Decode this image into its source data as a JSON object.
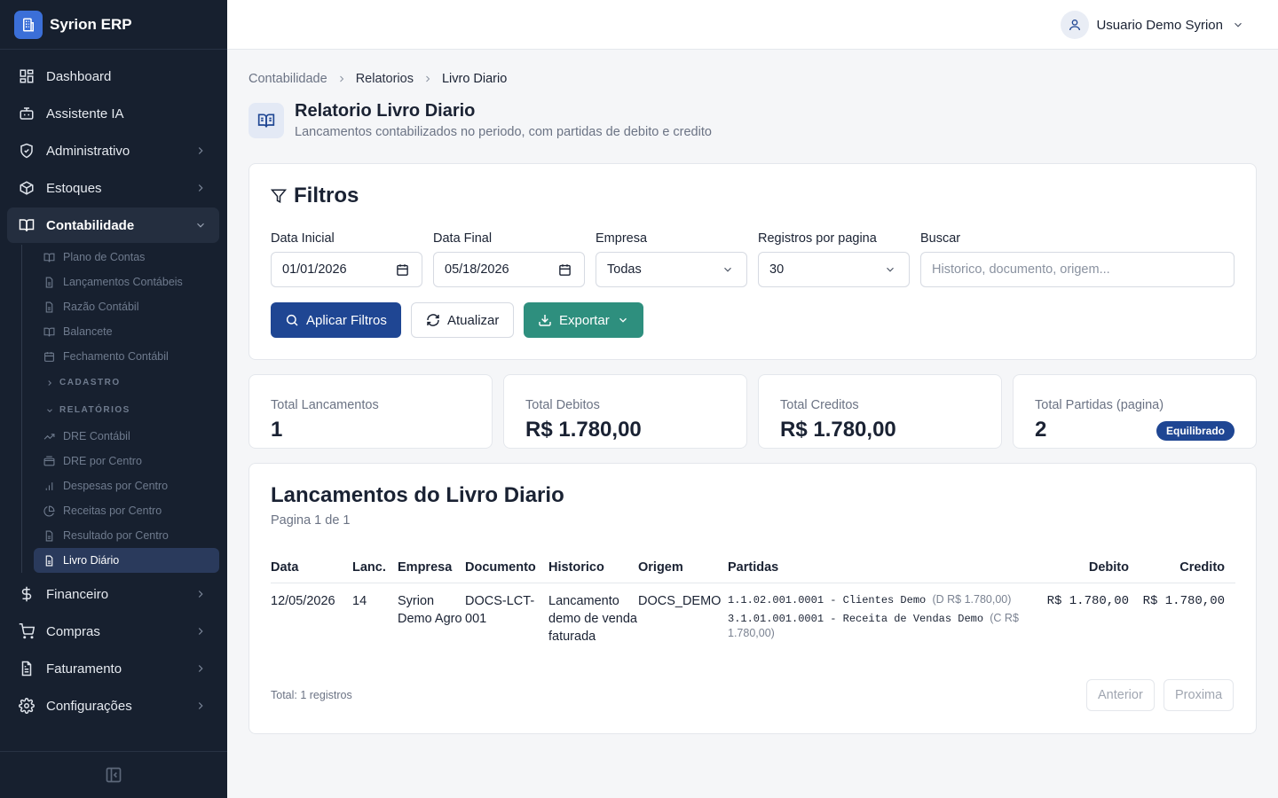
{
  "app": {
    "name": "Syrion ERP"
  },
  "user": {
    "name": "Usuario Demo Syrion"
  },
  "nav": {
    "dashboard": "Dashboard",
    "assistente": "Assistente IA",
    "administrativo": "Administrativo",
    "estoques": "Estoques",
    "contabilidade": "Contabilidade",
    "contab_items": [
      "Plano de Contas",
      "Lançamentos Contábeis",
      "Razão Contábil",
      "Balancete",
      "Fechamento Contábil"
    ],
    "cadastro_head": "CADASTRO",
    "relatorios_head": "RELATÓRIOS",
    "relatorios_items": [
      "DRE Contábil",
      "DRE por Centro",
      "Despesas por Centro",
      "Receitas por Centro",
      "Resultado por Centro",
      "Livro Diário"
    ],
    "financeiro": "Financeiro",
    "compras": "Compras",
    "faturamento": "Faturamento",
    "configuracoes": "Configurações"
  },
  "breadcrumb": [
    "Contabilidade",
    "Relatorios",
    "Livro Diario"
  ],
  "page": {
    "title": "Relatorio Livro Diario",
    "subtitle": "Lancamentos contabilizados no periodo, com partidas de debito e credito"
  },
  "filters": {
    "title": "Filtros",
    "data_inicial": {
      "label": "Data Inicial",
      "value": "01/01/2026"
    },
    "data_final": {
      "label": "Data Final",
      "value": "05/18/2026"
    },
    "empresa": {
      "label": "Empresa",
      "value": "Todas"
    },
    "registros": {
      "label": "Registros por pagina",
      "value": "30"
    },
    "buscar": {
      "label": "Buscar",
      "placeholder": "Historico, documento, origem..."
    },
    "apply": "Aplicar Filtros",
    "refresh": "Atualizar",
    "export": "Exportar"
  },
  "stats": [
    {
      "label": "Total Lancamentos",
      "value": "1"
    },
    {
      "label": "Total Debitos",
      "value": "R$ 1.780,00"
    },
    {
      "label": "Total Creditos",
      "value": "R$ 1.780,00"
    },
    {
      "label": "Total Partidas (pagina)",
      "value": "2",
      "badge": "Equilibrado"
    }
  ],
  "table": {
    "title": "Lancamentos do Livro Diario",
    "subtitle": "Pagina 1 de 1",
    "headers": [
      "Data",
      "Lanc.",
      "Empresa",
      "Documento",
      "Historico",
      "Origem",
      "Partidas",
      "Debito",
      "Credito"
    ],
    "rows": [
      {
        "data": "12/05/2026",
        "lanc": "14",
        "empresa": "Syrion Demo Agro",
        "documento": "DOCS-LCT-001",
        "historico": "Lancamento demo de venda faturada",
        "origem": "DOCS_DEMO",
        "partidas": [
          {
            "conta": "1.1.02.001.0001 - Clientes Demo",
            "valor": "(D R$ 1.780,00)"
          },
          {
            "conta": "3.1.01.001.0001 - Receita de Vendas Demo",
            "valor": "(C R$ 1.780,00)"
          }
        ],
        "debito": "R$ 1.780,00",
        "credito": "R$ 1.780,00"
      }
    ],
    "total": "Total: 1 registros",
    "prev": "Anterior",
    "next": "Proxima"
  },
  "colors": {
    "sidebar": "#17202f",
    "primary": "#1f4693",
    "teal": "#2e8f7e",
    "brand": "#3b6fd8"
  }
}
